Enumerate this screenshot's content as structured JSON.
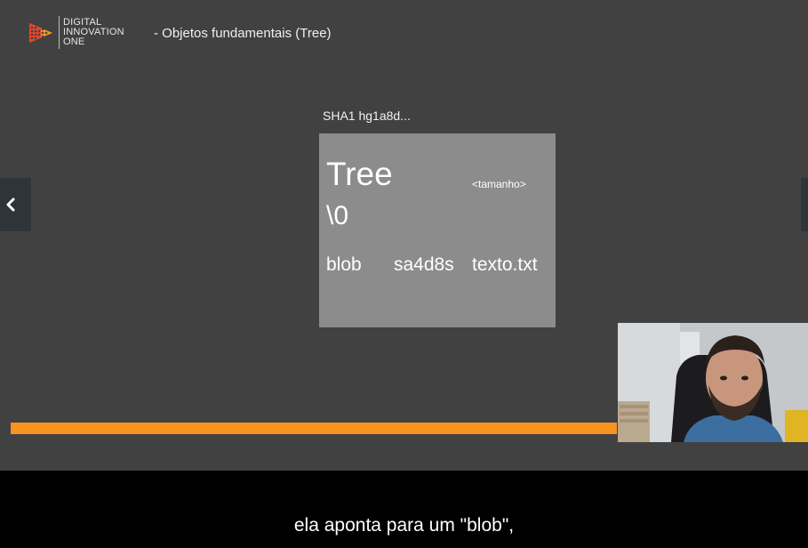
{
  "header": {
    "logo": {
      "line1": "DIGITAL",
      "line2": "INNOVATION",
      "line3": "ONE"
    },
    "title": "- Objetos fundamentais (Tree)"
  },
  "slide": {
    "sha_label": "SHA1 hg1a8d...",
    "tree": {
      "heading": "Tree",
      "size": "<tamanho>",
      "null": "\\0",
      "entry": {
        "type": "blob",
        "hash": "sa4d8s",
        "name": "texto.txt"
      }
    }
  },
  "navigation": {
    "prev_icon": "chevron-left-icon",
    "next_icon": "chevron-right-icon"
  },
  "progress": {
    "percent": 76
  },
  "caption": {
    "text": "ela aponta para um \"blob\","
  },
  "colors": {
    "background": "#414141",
    "box": "#8c8c8c",
    "accent": "#f7931e",
    "nav": "#2f3438"
  }
}
